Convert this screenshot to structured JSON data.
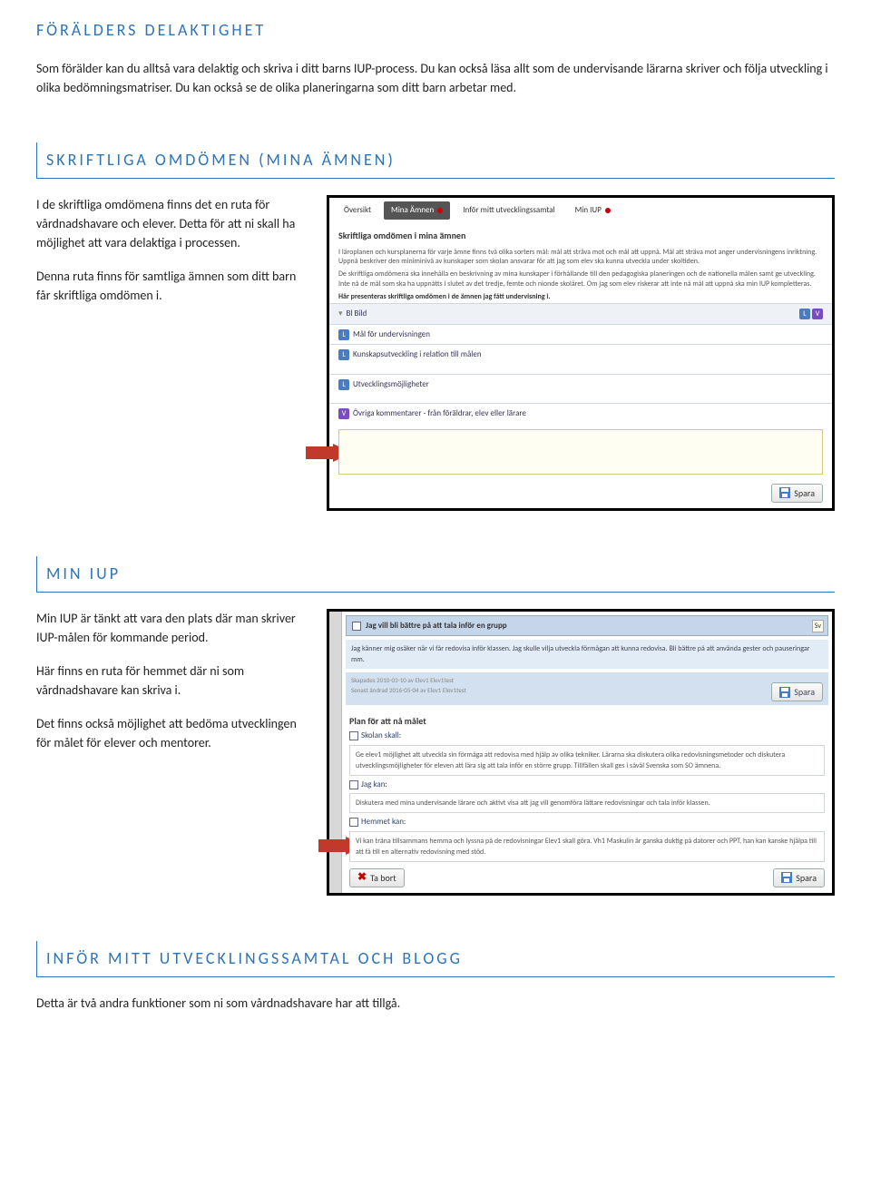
{
  "s1": {
    "title": "FÖRÄLDERS DELAKTIGHET",
    "p1": "Som förälder kan du alltså vara delaktig och skriva i ditt barns IUP-process. Du kan också läsa allt som de undervisande lärarna skriver och följa utveckling i olika bedömningsmatriser. Du kan också se de olika planeringarna som ditt barn arbetar med."
  },
  "s2": {
    "title": "SKRIFTLIGA OMDÖMEN (MINA ÄMNEN)",
    "p1": "I de skriftliga omdömena finns det en ruta för vårdnadshavare och elever. Detta för att ni skall ha möjlighet att vara delaktiga i processen.",
    "p2": "Denna ruta finns för samtliga ämnen som ditt barn får skriftliga omdömen i.",
    "shot": {
      "tabs": {
        "overview": "Översikt",
        "mina": "Mina Ämnen",
        "infor": "Inför mitt utvecklingssamtal",
        "miniup": "Min IUP"
      },
      "h": "Skriftliga omdömen i mina ämnen",
      "p1": "I läroplanen och kursplanerna för varje ämne finns två olika sorters mål: mål att sträva mot och mål att uppnå. Mål att sträva mot anger undervisningens inriktning. Uppnå beskriver den miniminivå av kunskaper som skolan ansvarar för att jag som elev ska kunna utveckla under skoltiden.",
      "p2": "De skriftliga omdömena ska innehålla en beskrivning av mina kunskaper i förhållande till den pedagogiska planeringen och de nationella målen samt ge utveckling. Inte nå de mål som ska ha uppnåtts i slutet av det tredje, femte och nionde skolåret. Om jag som elev riskerar att inte nå mål att uppnå ska min IUP kompletteras.",
      "p3": "Här presenteras skriftliga omdömen i de ämnen jag fått undervisning i.",
      "subj": "Bl  Bild",
      "f1": "Mål för undervisningen",
      "f2": "Kunskapsutveckling i relation till målen",
      "f3": "Utvecklingsmöjligheter",
      "f4": "Övriga kommentarer - från föräldrar, elev eller lärare",
      "spara": "Spara"
    }
  },
  "s3": {
    "title": "MIN IUP",
    "p1": "Min IUP är tänkt att vara den plats där man skriver IUP-målen för kommande period.",
    "p2": "Här finns en ruta för hemmet där ni som vårdnadshavare kan skriva i.",
    "p3": "Det finns också möjlighet att bedöma utvecklingen för målet för elever och mentorer.",
    "shot": {
      "goal_title": "Jag vill bli bättre på att tala inför en grupp",
      "goal_body": "Jag känner mig osäker när vi får redovisa inför klassen. Jag skulle vilja utveckla förmågan att kunna redovisa. Bli bättre på att använda gester och pauseringar mm.",
      "meta1": "Skapades 2010-03-10 av Elev1 Elev1test",
      "meta2": "Senast ändrad 2016-05-04 av Elev1 Elev1test",
      "plan": "Plan för att nå målet",
      "box1_h": "Skolan skall:",
      "box1_t": "Ge elev1 möjlighet att utveckla sin förmåga att redovisa med hjälp av olika tekniker. Lärarna ska diskutera olika redovisningsmetoder och diskutera utvecklingsmöjligheter för eleven att lära sig att tala inför en större grupp. Tillfällen skall ges i såväl Svenska som SO ämnena.",
      "box2_h": "Jag kan:",
      "box2_t": "Diskutera med mina undervisande lärare och aktivt visa att jag vill genomföra lättare redovisningar och tala inför klassen.",
      "box3_h": "Hemmet kan:",
      "box3_t": "Vi kan träna tillsammans hemma och lyssna på de redovisningar Elev1 skall göra. Vh1 Maskulin är ganska duktig på datorer och PPT, han kan kanske hjälpa till att få till en alternativ redovisning med stöd.",
      "spara": "Spara",
      "tabort": "Ta bort",
      "sv": "Sv"
    }
  },
  "s4": {
    "title": "INFÖR MITT UTVECKLINGSSAMTAL OCH BLOGG",
    "p1": "Detta är två andra funktioner som ni som vårdnadshavare har att tillgå."
  }
}
